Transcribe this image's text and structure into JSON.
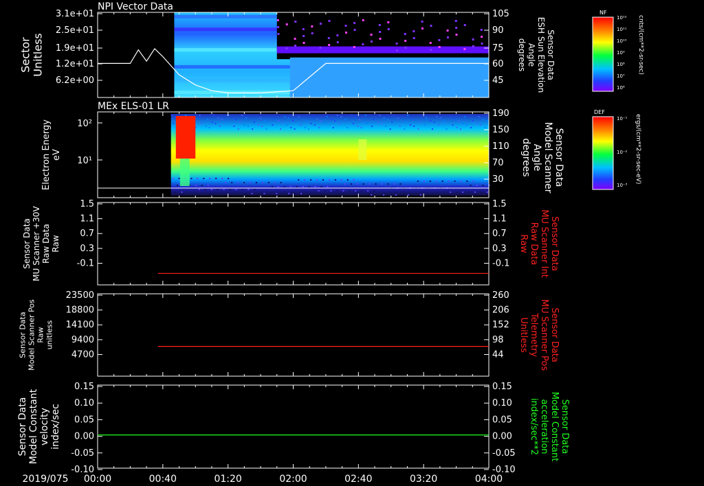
{
  "time_axis": {
    "date_label": "2019/075",
    "tick_labels": [
      "00:00",
      "00:40",
      "01:20",
      "02:00",
      "02:40",
      "03:20",
      "04:00"
    ]
  },
  "colors": {
    "axis": "#ffffff",
    "red_trace": "#ff2020",
    "green_trace": "#20ff20",
    "bg": "#000000"
  },
  "panels": [
    {
      "id": "p1",
      "title": "NPI Vector Data",
      "left_label": [
        "Sector",
        "Unitless"
      ],
      "left_ticks": [
        "3.1e+01",
        "2.5e+01",
        "1.9e+01",
        "1.2e+01",
        "6.2e+00"
      ],
      "right_ticks": [
        "105",
        "90",
        "75",
        "60",
        "45"
      ],
      "right_label": [
        "Sensor Data",
        "ESH Sun Elevation",
        "Angle",
        "degrees"
      ],
      "colorbar": {
        "title": "NF",
        "unit": "cnts/(cm**2-sr-sec)",
        "ticks": [
          "10¹²",
          "10¹¹",
          "10¹⁰",
          "10⁹",
          "10⁸",
          "10⁷",
          "10⁶"
        ]
      }
    },
    {
      "id": "p2",
      "title": "MEx ELS-01 LR",
      "left_label": [
        "Electron Energy",
        "eV"
      ],
      "left_ticks": [
        "10²",
        "10¹"
      ],
      "right_ticks": [
        "190",
        "150",
        "110",
        "70",
        "30"
      ],
      "right_label": [
        "Sensor Data",
        "Model Scanner",
        "Angle",
        "degrees"
      ],
      "colorbar": {
        "title": "DEF",
        "unit": "ergs/(cm**2-sr-sec-eV)",
        "ticks": [
          "10⁻³",
          "10⁻²",
          "10⁻¹"
        ]
      }
    },
    {
      "id": "p3",
      "left_label": [
        "Sensor Data",
        "MU Scanner +30V",
        "Raw Data",
        "Raw"
      ],
      "left_ticks": [
        "1.5",
        "1.1",
        "0.7",
        "0.3",
        "-0.1"
      ],
      "right_ticks": [
        "1.5",
        "1.1",
        "0.7",
        "0.3",
        "-0.1"
      ],
      "right_label": [
        "Sensor Data",
        "MU Scanner Int",
        "Raw Data",
        "Raw"
      ]
    },
    {
      "id": "p4",
      "left_label": [
        "Sensor Data",
        "Model Scanner Pos",
        "Raw",
        "unitless"
      ],
      "left_ticks": [
        "23500",
        "18800",
        "14100",
        "9400",
        "4700"
      ],
      "right_ticks": [
        "260",
        "206",
        "152",
        "98",
        "44"
      ],
      "right_label": [
        "Sensor Data",
        "MU Scanner Pos",
        "Telemetry",
        "Unitless"
      ]
    },
    {
      "id": "p5",
      "left_label": [
        "Sensor Data",
        "Model Constant",
        "velocity",
        "index/sec"
      ],
      "left_ticks": [
        "0.15",
        "0.10",
        "0.05",
        "0.00",
        "-0.05",
        "-0.10"
      ],
      "right_ticks": [
        "0.15",
        "0.10",
        "0.05",
        "0.00",
        "-0.05",
        "-0.10"
      ],
      "right_label": [
        "Sensor Data",
        "Model Constant",
        "acceleration",
        "index/sec**2"
      ]
    }
  ],
  "chart_data": [
    {
      "type": "heatmap",
      "title": "NPI Vector Data",
      "ylabel": "Sector Unitless",
      "y2label": "Sensor Data ESH Sun Elevation Angle degrees",
      "xlim": [
        "00:00",
        "04:00"
      ],
      "data_start": "00:47",
      "overlay_line_x": [
        "00:00",
        "00:10",
        "00:20",
        "00:25",
        "00:30",
        "00:35",
        "00:40",
        "00:50",
        "01:00",
        "01:10",
        "01:20",
        "01:30",
        "01:40",
        "01:50",
        "02:00",
        "02:10",
        "02:20",
        "02:30",
        "02:40",
        "03:00",
        "03:20",
        "03:40",
        "04:00"
      ],
      "overlay_line_y2": [
        60,
        60,
        60,
        72,
        62,
        73,
        66,
        50,
        41,
        36,
        34,
        34,
        34,
        35,
        36,
        48,
        60,
        60,
        60,
        60,
        60,
        60,
        60
      ]
    },
    {
      "type": "heatmap",
      "title": "MEx ELS-01 LR",
      "ylabel": "Electron Energy eV",
      "y2label": "Sensor Data Model Scanner Angle degrees",
      "xlim": [
        "00:00",
        "04:00"
      ],
      "data_start": "00:45",
      "overlay_line_x": [
        "00:00",
        "04:00"
      ],
      "overlay_line_y2": [
        0,
        0
      ]
    },
    {
      "type": "line",
      "xlim": [
        "00:00",
        "04:00"
      ],
      "ylim": [
        -0.3,
        1.5
      ],
      "series": [
        {
          "x": [
            "00:37",
            "04:00"
          ],
          "values": [
            -0.05,
            -0.05
          ]
        }
      ]
    },
    {
      "type": "line",
      "xlim": [
        "00:00",
        "04:00"
      ],
      "ylim": [
        0,
        23500
      ],
      "series": [
        {
          "x": [
            "00:37",
            "04:00"
          ],
          "values": [
            8500,
            8500
          ]
        }
      ]
    },
    {
      "type": "line",
      "xlim": [
        "00:00",
        "04:00"
      ],
      "ylim": [
        -0.1,
        0.15
      ],
      "series": [
        {
          "x": [
            "00:00",
            "04:00"
          ],
          "values": [
            0.0,
            0.0
          ]
        }
      ]
    }
  ]
}
